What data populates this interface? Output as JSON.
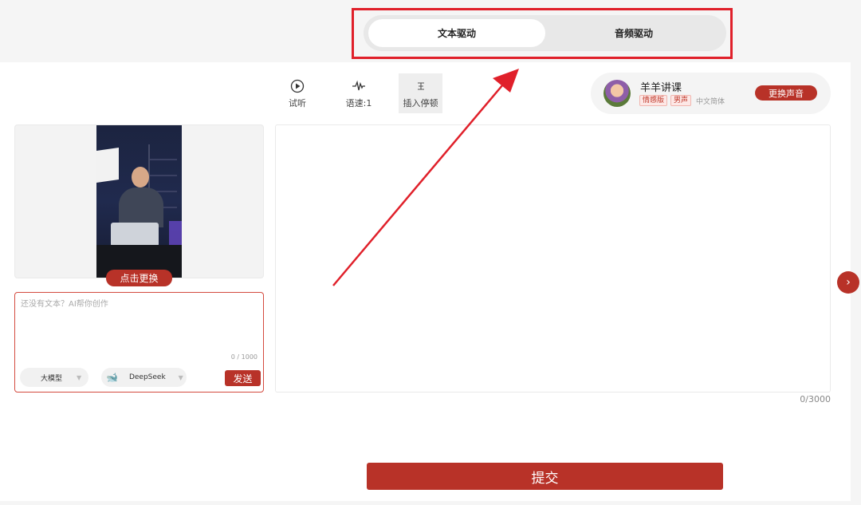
{
  "drive_tabs": {
    "text_drive": "文本驱动",
    "audio_drive": "音频驱动",
    "active": "text_drive"
  },
  "toolbar": {
    "listen_label": "试听",
    "speed_label": "语速:1",
    "pause_label": "插入停顿"
  },
  "voice": {
    "name": "羊羊讲课",
    "tags": [
      "情感版",
      "男声"
    ],
    "language": "中文简体",
    "change_label": "更换声音"
  },
  "preview": {
    "replace_label": "点击更换"
  },
  "ai_assist": {
    "placeholder": "还没有文本？AI帮你创作",
    "value": "",
    "counter": "0 / 1000",
    "model_label": "大模型",
    "engine_label": "DeepSeek",
    "send_label": "发送"
  },
  "script": {
    "value": "",
    "counter": "0/3000"
  },
  "next_icon": "chevron-right",
  "submit_label": "提交",
  "colors": {
    "accent": "#b83228",
    "annotation": "#e0202a"
  }
}
